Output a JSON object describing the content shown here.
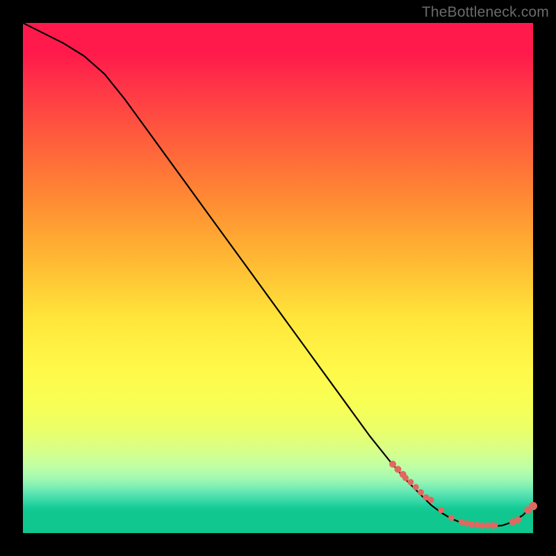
{
  "watermark": "TheBottleneck.com",
  "chart_data": {
    "type": "line",
    "title": "",
    "xlabel": "",
    "ylabel": "",
    "xlim": [
      0,
      100
    ],
    "ylim": [
      0,
      100
    ],
    "series": [
      {
        "name": "bottleneck-curve",
        "x": [
          0,
          4,
          8,
          12,
          16,
          20,
          24,
          28,
          32,
          36,
          40,
          44,
          48,
          52,
          56,
          60,
          64,
          68,
          72,
          75,
          78,
          80,
          82,
          84,
          86,
          88,
          90,
          92,
          94,
          96,
          98,
          100
        ],
        "y": [
          100,
          98,
          96,
          93.5,
          90,
          85,
          79.5,
          74,
          68.5,
          63,
          57.5,
          52,
          46.5,
          41,
          35.5,
          30,
          24.5,
          19,
          14,
          10.5,
          7.5,
          5.5,
          4,
          2.8,
          2,
          1.5,
          1.3,
          1.3,
          1.5,
          2.2,
          3.5,
          5.5
        ]
      }
    ],
    "points": {
      "name": "highlight-dots",
      "x": [
        72.5,
        73.5,
        74.5,
        75,
        76,
        77,
        78,
        79,
        80,
        82,
        84,
        86,
        87,
        88,
        89,
        90,
        91,
        92,
        92.5,
        96,
        97,
        99,
        100
      ],
      "y": [
        13.5,
        12.5,
        11.5,
        10.8,
        10,
        9,
        8,
        7,
        6.5,
        4.5,
        3,
        2.2,
        1.9,
        1.7,
        1.6,
        1.5,
        1.5,
        1.5,
        1.5,
        2.2,
        2.6,
        4.5,
        5.3
      ],
      "r": [
        5,
        5,
        5,
        4.5,
        4.5,
        4.5,
        4.5,
        4.5,
        4.5,
        4.5,
        4.5,
        4.5,
        4.5,
        4.5,
        4.5,
        4.5,
        4.5,
        4.5,
        4.5,
        5,
        5,
        5.5,
        6
      ]
    },
    "gradient_bands": [
      {
        "pos": 0.0,
        "color": "#ff1a4b"
      },
      {
        "pos": 0.35,
        "color": "#ff8c33"
      },
      {
        "pos": 0.62,
        "color": "#fff94a"
      },
      {
        "pos": 0.95,
        "color": "#0fc78f"
      }
    ]
  }
}
